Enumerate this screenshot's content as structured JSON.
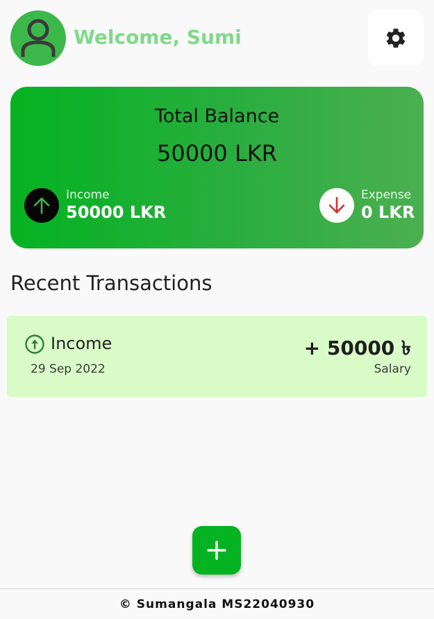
{
  "header": {
    "welcome_text": "Welcome, Sumi",
    "avatar_icon": "user-icon",
    "settings_icon": "gear-icon"
  },
  "balance_card": {
    "title": "Total Balance",
    "amount": "50000 LKR",
    "income": {
      "label": "Income",
      "amount": "50000 LKR",
      "icon": "arrow-up-icon"
    },
    "expense": {
      "label": "Expense",
      "amount": "0 LKR",
      "icon": "arrow-down-icon"
    }
  },
  "recent_transactions": {
    "title": "Recent Transactions",
    "items": [
      {
        "type": "Income",
        "date": "29 Sep 2022",
        "amount": "+ 50000 ৳",
        "category": "Salary",
        "icon": "arrow-up-circle-icon"
      }
    ]
  },
  "fab": {
    "icon": "plus-icon"
  },
  "footer": {
    "text": "© Sumangala MS22040930"
  },
  "colors": {
    "accent": "#05b221",
    "welcome_text": "#7fd98a",
    "transaction_bg": "#d9fbc8",
    "expense_arrow": "#d32f2f"
  }
}
